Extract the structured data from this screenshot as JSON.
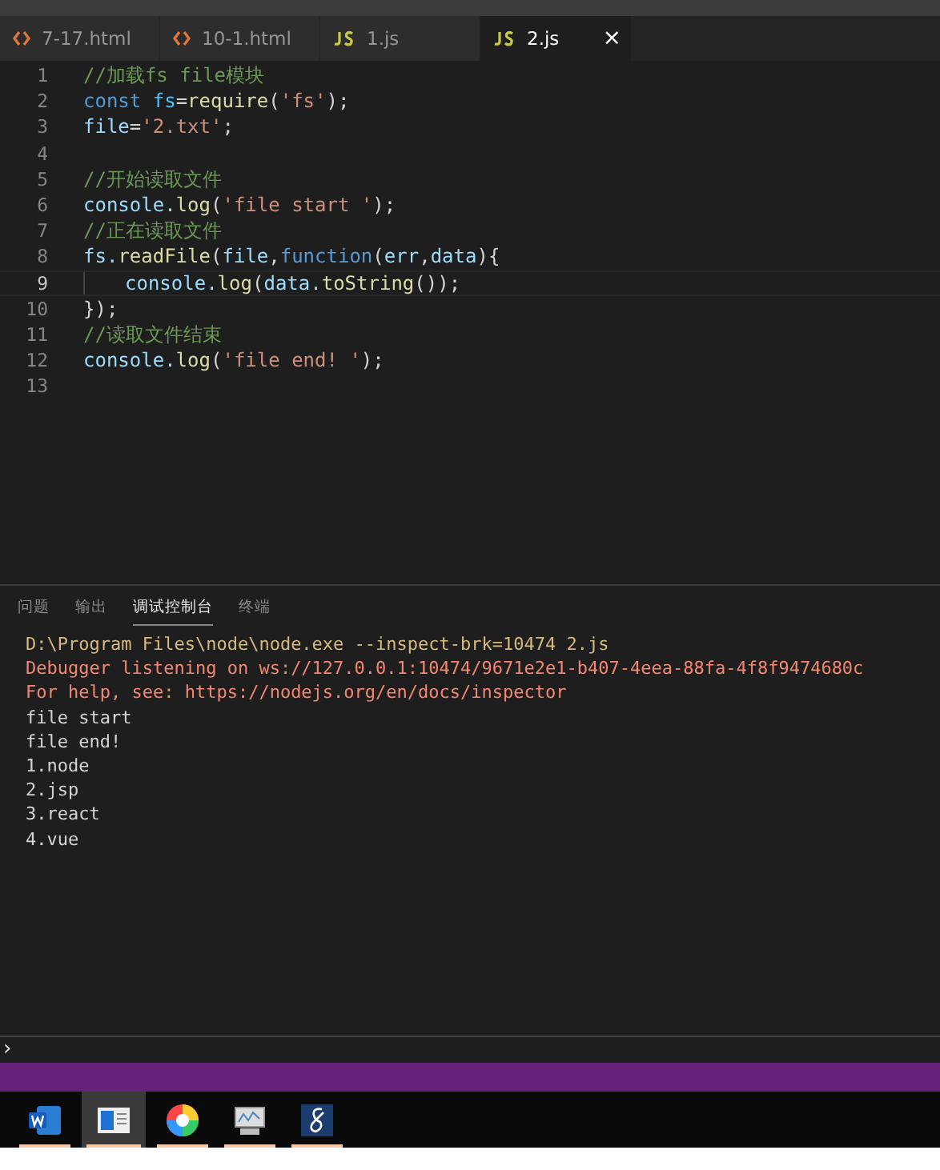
{
  "tabs": [
    {
      "label": "7-17.html",
      "kind": "html",
      "selected": false
    },
    {
      "label": "10-1.html",
      "kind": "html",
      "selected": false
    },
    {
      "label": "1.js",
      "kind": "js",
      "selected": false
    },
    {
      "label": "2.js",
      "kind": "js",
      "selected": true,
      "close": "×"
    }
  ],
  "code": [
    {
      "number": "1",
      "current": false,
      "tokens": [
        {
          "kind": "comment",
          "text": "//加载fs file模块"
        }
      ]
    },
    {
      "number": "2",
      "current": false,
      "tokens": [
        {
          "kind": "keyword",
          "text": "const "
        },
        {
          "kind": "constant",
          "text": "fs"
        },
        {
          "kind": "punct",
          "text": "="
        },
        {
          "kind": "function",
          "text": "require"
        },
        {
          "kind": "punct",
          "text": "("
        },
        {
          "kind": "string",
          "text": "'fs'"
        },
        {
          "kind": "punct",
          "text": ");"
        }
      ]
    },
    {
      "number": "3",
      "current": false,
      "tokens": [
        {
          "kind": "variable",
          "text": "file"
        },
        {
          "kind": "punct",
          "text": "="
        },
        {
          "kind": "string",
          "text": "'2.txt'"
        },
        {
          "kind": "punct",
          "text": ";"
        }
      ]
    },
    {
      "number": "4",
      "current": false
    },
    {
      "number": "5",
      "current": false,
      "tokens": [
        {
          "kind": "comment",
          "text": "//开始读取文件"
        }
      ]
    },
    {
      "number": "6",
      "current": false,
      "tokens": [
        {
          "kind": "variable",
          "text": "console."
        },
        {
          "kind": "function",
          "text": "log"
        },
        {
          "kind": "punct",
          "text": "("
        },
        {
          "kind": "string",
          "text": "'file start '"
        },
        {
          "kind": "punct",
          "text": ");"
        }
      ]
    },
    {
      "number": "7",
      "current": false,
      "tokens": [
        {
          "kind": "comment",
          "text": "//正在读取文件"
        }
      ]
    },
    {
      "number": "8",
      "current": false,
      "tokens": [
        {
          "kind": "variable",
          "text": "fs."
        },
        {
          "kind": "function",
          "text": "readFile"
        },
        {
          "kind": "punct",
          "text": "("
        },
        {
          "kind": "variable",
          "text": "file"
        },
        {
          "kind": "punct",
          "text": ","
        },
        {
          "kind": "keyword",
          "text": "function"
        },
        {
          "kind": "punct",
          "text": "("
        },
        {
          "kind": "variable",
          "text": "err"
        },
        {
          "kind": "punct",
          "text": ","
        },
        {
          "kind": "variable",
          "text": "data"
        },
        {
          "kind": "punct",
          "text": "){"
        }
      ]
    },
    {
      "number": "9",
      "current": true,
      "indent": true,
      "tokens": [
        {
          "kind": "variable",
          "text": "console."
        },
        {
          "kind": "function",
          "text": "log"
        },
        {
          "kind": "punct",
          "text": "("
        },
        {
          "kind": "variable",
          "text": "data."
        },
        {
          "kind": "function",
          "text": "toString"
        },
        {
          "kind": "punct",
          "text": "());"
        }
      ]
    },
    {
      "number": "10",
      "current": false,
      "tokens": [
        {
          "kind": "punct",
          "text": "});"
        }
      ]
    },
    {
      "number": "11",
      "current": false,
      "tokens": [
        {
          "kind": "comment",
          "text": "//读取文件结束"
        }
      ]
    },
    {
      "number": "12",
      "current": false,
      "tokens": [
        {
          "kind": "variable",
          "text": "console."
        },
        {
          "kind": "function",
          "text": "log"
        },
        {
          "kind": "punct",
          "text": "("
        },
        {
          "kind": "string",
          "text": "'file end! '"
        },
        {
          "kind": "punct",
          "text": ");"
        }
      ]
    },
    {
      "number": "13",
      "current": false
    }
  ],
  "panel_tabs": [
    {
      "label": "问题",
      "selected": false
    },
    {
      "label": "输出",
      "selected": false
    },
    {
      "label": "调试控制台",
      "selected": true
    },
    {
      "label": "终端",
      "selected": false
    }
  ],
  "output": [
    {
      "kind": "command",
      "text": "D:\\Program Files\\node\\node.exe --inspect-brk=10474 2.js"
    },
    {
      "kind": "error",
      "text": "Debugger listening on ws://127.0.0.1:10474/9671e2e1-b407-4eea-88fa-4f8f9474680c"
    },
    {
      "kind": "error",
      "text": "For help, see: https://nodejs.org/en/docs/inspector"
    },
    {
      "kind": "plain",
      "text": "file start"
    },
    {
      "kind": "plain",
      "text": "file end!"
    },
    {
      "kind": "plain",
      "text": "1.node"
    },
    {
      "kind": "plain",
      "text": "2.jsp"
    },
    {
      "kind": "plain",
      "text": "3.react"
    },
    {
      "kind": "plain",
      "text": "4.vue"
    }
  ],
  "prompt": "›",
  "taskbar": [
    {
      "kind": "word",
      "selected": false
    },
    {
      "kind": "window",
      "selected": true
    },
    {
      "kind": "wheel",
      "selected": false
    },
    {
      "kind": "monitor",
      "selected": false
    },
    {
      "kind": "script",
      "selected": false
    }
  ]
}
